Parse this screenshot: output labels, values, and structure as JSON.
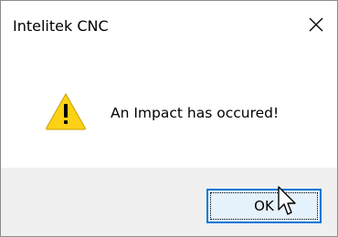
{
  "window": {
    "title": "Intelitek CNC",
    "close_icon": "close-icon"
  },
  "dialog": {
    "icon": "warning-icon",
    "message": "An Impact has occured!"
  },
  "buttons": {
    "ok_label": "OK"
  },
  "colors": {
    "accent": "#0078d7",
    "button_bg": "#e5f1fb",
    "footer_bg": "#f0f0f0",
    "warning_fill": "#fcd116"
  }
}
